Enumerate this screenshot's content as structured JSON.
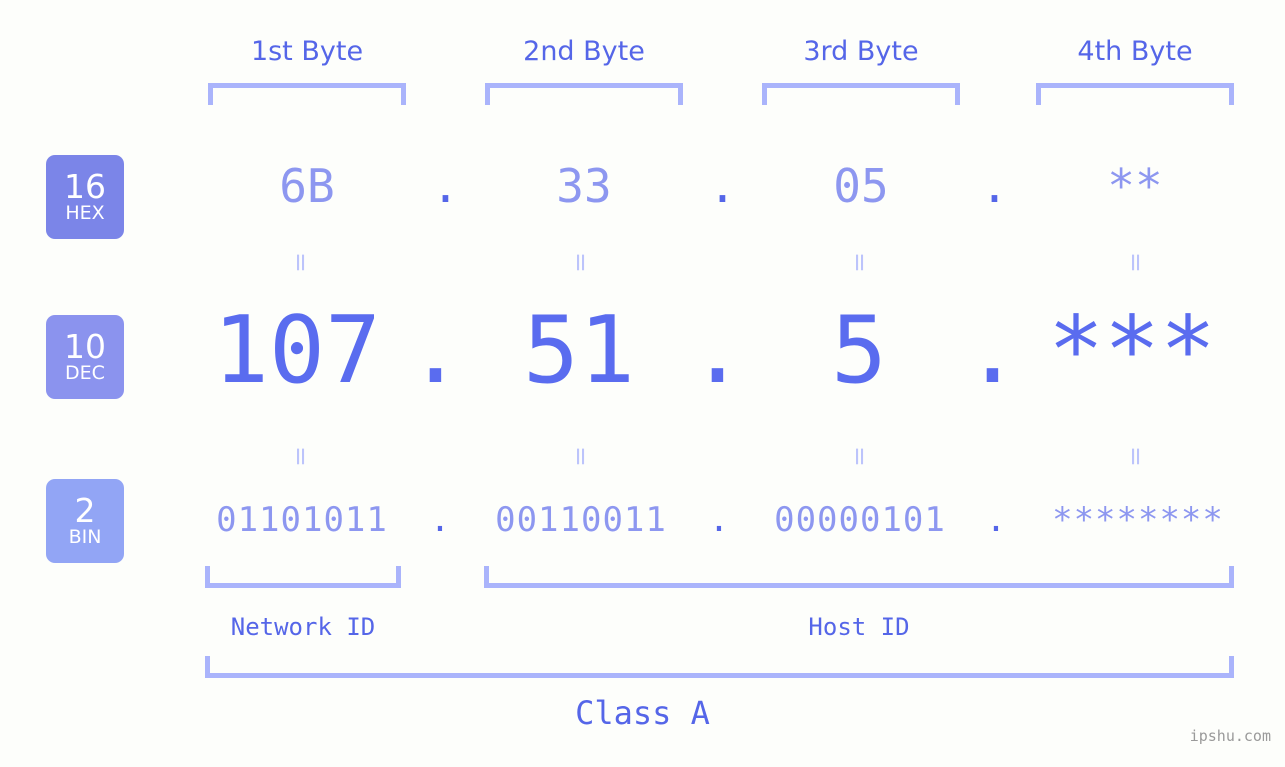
{
  "background_color": "#fdfefb",
  "accent_colors": {
    "header_blue": "#5566e8",
    "bracket_blue": "#aab4fb",
    "light_value_blue": "#8d97f0",
    "dec_value_blue": "#5a6cef",
    "equals_blue": "#bcc4fb",
    "badge_hex": "#7b85e8",
    "badge_dec": "#8b93ee",
    "badge_bin": "#92a5f5",
    "watermark_gray": "#9a9a9a"
  },
  "byte_headers": [
    {
      "label": "1st Byte"
    },
    {
      "label": "2nd Byte"
    },
    {
      "label": "3rd Byte"
    },
    {
      "label": "4th Byte"
    }
  ],
  "bases": [
    {
      "number": "16",
      "name": "HEX"
    },
    {
      "number": "10",
      "name": "DEC"
    },
    {
      "number": "2",
      "name": "BIN"
    }
  ],
  "rows": {
    "hex": {
      "base_number": "16",
      "base_name": "HEX",
      "bytes": [
        "6B",
        "33",
        "05",
        "**"
      ],
      "separators": [
        ".",
        ".",
        "."
      ]
    },
    "dec": {
      "base_number": "10",
      "base_name": "DEC",
      "bytes": [
        "107",
        "51",
        "5",
        "***"
      ],
      "separators": [
        ".",
        ".",
        "."
      ]
    },
    "bin": {
      "base_number": "2",
      "base_name": "BIN",
      "bytes": [
        "01101011",
        "00110011",
        "00000101",
        "********"
      ],
      "separators": [
        ".",
        ".",
        "."
      ]
    }
  },
  "equals_symbol": "=",
  "id_labels": [
    {
      "label": "Network ID"
    },
    {
      "label": "Host ID"
    }
  ],
  "class_label": "Class A",
  "watermark": "ipshu.com"
}
